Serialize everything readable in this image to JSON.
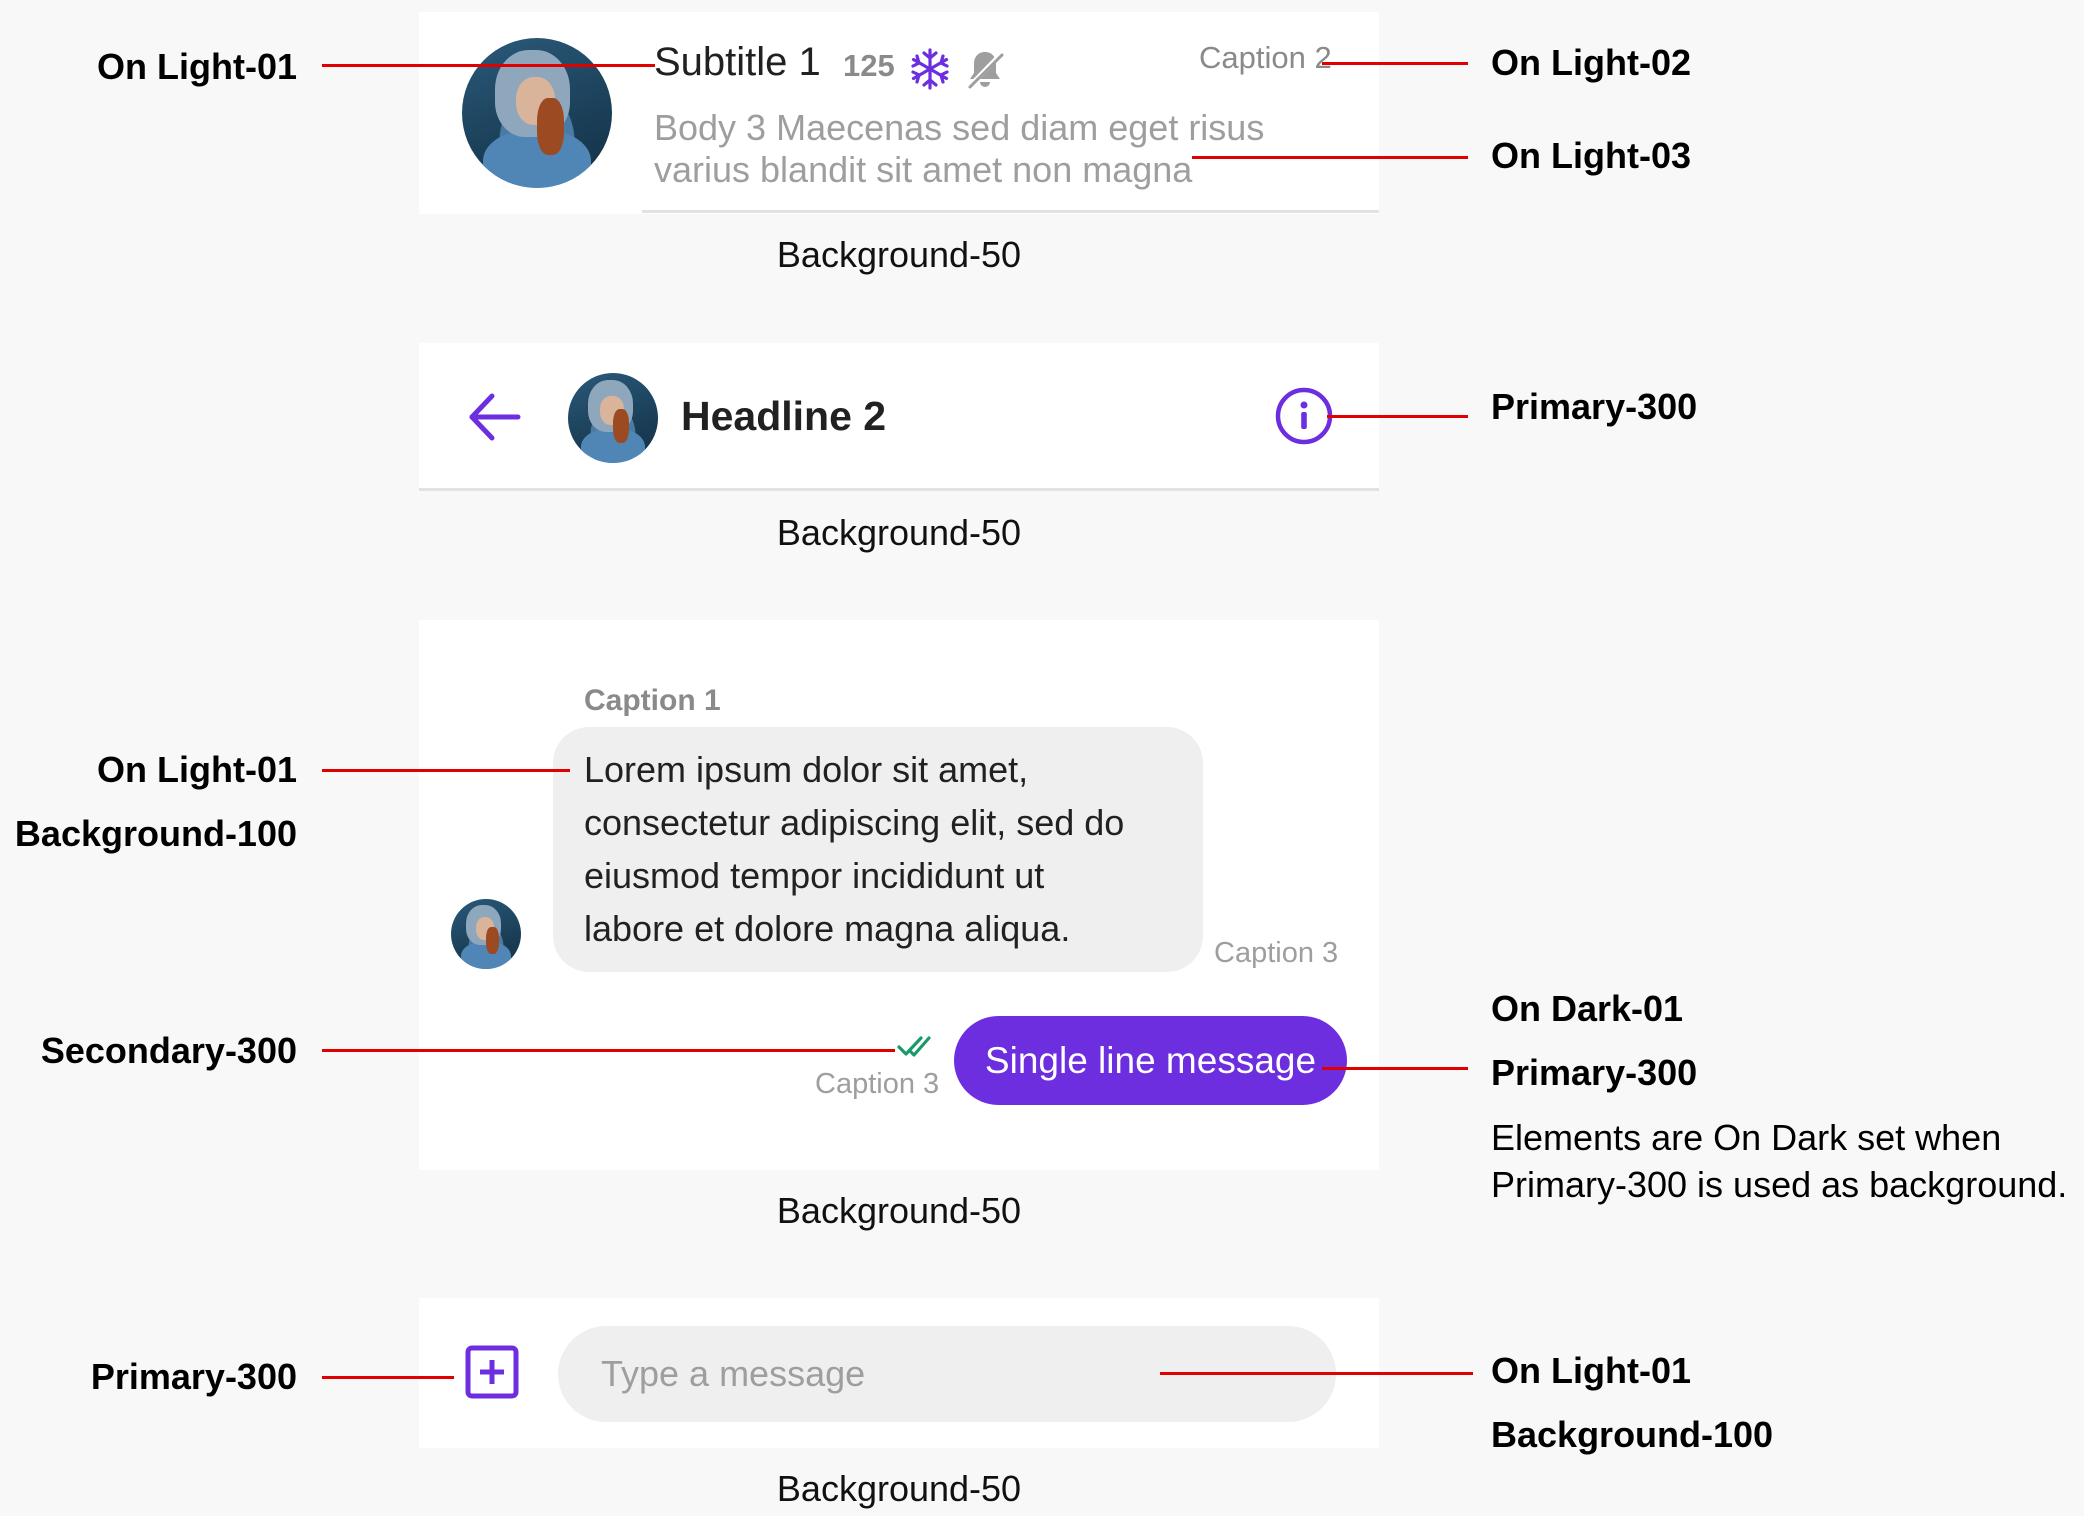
{
  "colors": {
    "primary_300": "#6d2ee0",
    "secondary_300": "#1a9a6a",
    "annotation_line": "#e00000",
    "background_50": "#ffffff",
    "background_100": "#efefef",
    "on_light_01": "#212121",
    "on_light_02": "#8a8a8a",
    "on_light_03": "#9e9e9e",
    "on_dark_01": "#ffffff"
  },
  "list_item": {
    "title": "Subtitle 1",
    "count": "125",
    "caption": "Caption 2",
    "body_line1": "Body 3 Maecenas sed diam eget risus",
    "body_line2": "varius blandit sit amet non magna",
    "icons": [
      "snowflake-icon",
      "bell-off-icon"
    ],
    "background_label": "Background-50"
  },
  "app_bar": {
    "title": "Headline 2",
    "icons": [
      "arrow-back-icon",
      "info-icon"
    ],
    "background_label": "Background-50"
  },
  "chat": {
    "incoming_caption": "Caption 1",
    "incoming_lines": [
      "Lorem ipsum dolor sit amet,",
      "consectetur adipiscing elit, sed do",
      "eiusmod tempor incididunt ut",
      "labore et dolore magna aliqua."
    ],
    "incoming_time": "Caption 3",
    "outgoing_text": "Single line message",
    "outgoing_time": "Caption 3",
    "read_icon": "double-check-icon",
    "background_label": "Background-50"
  },
  "composer": {
    "placeholder": "Type a message",
    "add_icon": "add-box-icon",
    "background_label": "Background-50"
  },
  "annotations": {
    "on_light_01_a": "On Light-01",
    "on_light_02": "On Light-02",
    "on_light_03": "On Light-03",
    "primary_300_a": "Primary-300",
    "on_light_01_b": "On Light-01",
    "background_100_a": "Background-100",
    "secondary_300": "Secondary-300",
    "on_dark_01": "On Dark-01",
    "primary_300_b": "Primary-300",
    "note_line1": "Elements are On Dark set when",
    "note_line2": "Primary-300 is used as background.",
    "primary_300_c": "Primary-300",
    "on_light_01_c": "On Light-01",
    "background_100_b": "Background-100"
  }
}
